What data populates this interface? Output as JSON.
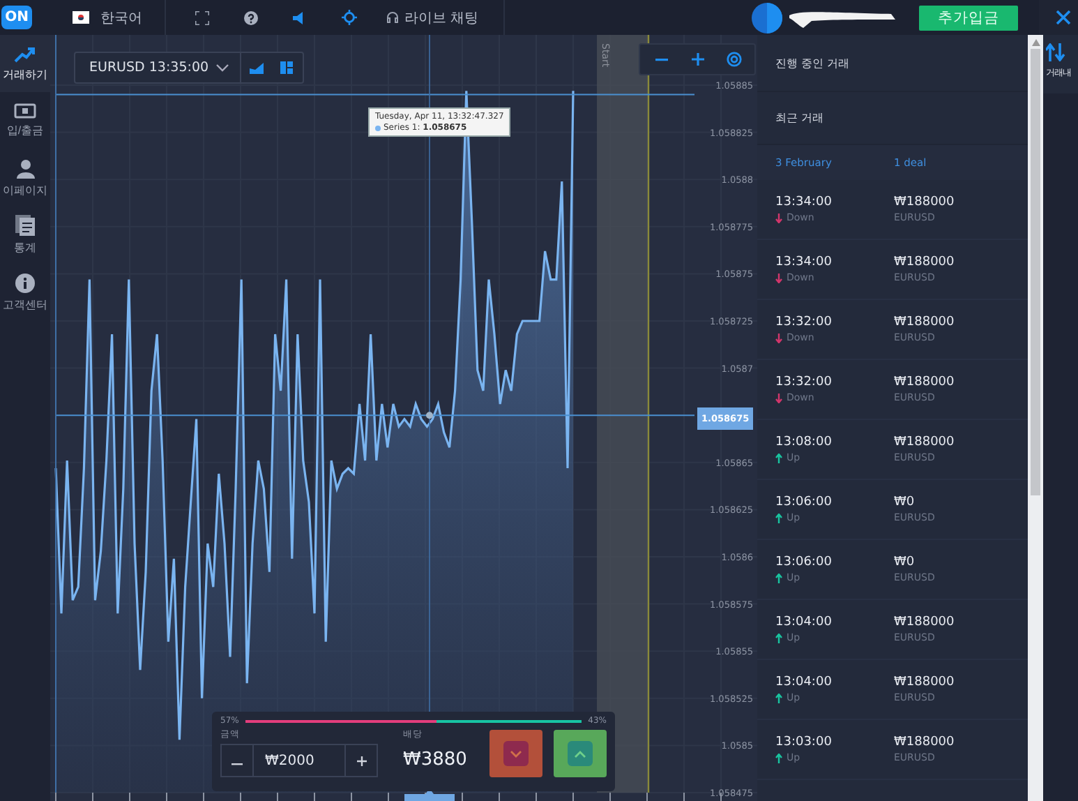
{
  "logo": {
    "text": "ON"
  },
  "top_bar": {
    "language": "한국어",
    "live_chat": "라이브 채팅",
    "deposit_button": "추가입금"
  },
  "sidebar": {
    "items": [
      {
        "label": "거래하기",
        "kind": "trend",
        "selected": true
      },
      {
        "label": "입/출금",
        "kind": "cash",
        "selected": false
      },
      {
        "label": "이페이지",
        "kind": "person",
        "selected": false
      },
      {
        "label": "통계",
        "kind": "document",
        "selected": false
      },
      {
        "label": "고객센터",
        "kind": "info",
        "selected": false
      }
    ]
  },
  "asset_selector": {
    "label": "EURUSD 13:35:00"
  },
  "chart": {
    "tooltip": {
      "date": "Tuesday, Apr 11, 13:32:47.327",
      "series_suffix": ":",
      "value": "1.058675"
    },
    "price_tag": "1.058675",
    "start_label": "Start",
    "chart_data": {
      "type": "area",
      "ylim": [
        1.058475,
        1.058875
      ],
      "grid": true,
      "ref_lines": [
        {
          "axis": "y",
          "value": 1.058845
        },
        {
          "axis": "y",
          "value": 1.058675
        }
      ],
      "yticks": [
        1.05885,
        1.058825,
        1.0588,
        1.058775,
        1.05875,
        1.058725,
        1.0587,
        1.05865,
        1.058625,
        1.0586,
        1.058575,
        1.05855,
        1.058525,
        1.0585,
        1.058475
      ],
      "series": [
        {
          "name": "Series 1",
          "color": "#7ab4f0",
          "values": [
            1.058647,
            1.05857,
            1.058651,
            1.058577,
            1.058584,
            1.058647,
            1.058747,
            1.058577,
            1.058603,
            1.058651,
            1.058718,
            1.05857,
            1.058636,
            1.058747,
            1.058607,
            1.05854,
            1.058592,
            1.058688,
            1.058718,
            1.058651,
            1.058555,
            1.058599,
            1.058503,
            1.058584,
            1.058629,
            1.058673,
            1.058525,
            1.058607,
            1.058584,
            1.058644,
            1.058607,
            1.058547,
            1.058636,
            1.058747,
            1.058533,
            1.058607,
            1.058651,
            1.058636,
            1.058592,
            1.058718,
            1.058688,
            1.058747,
            1.058599,
            1.058718,
            1.058651,
            1.058629,
            1.05857,
            1.058747,
            1.058555,
            1.058651,
            1.058636,
            1.058644,
            1.058647,
            1.058644,
            1.058681,
            1.058651,
            1.058718,
            1.058651,
            1.058681,
            1.058658,
            1.058681,
            1.058669,
            1.058673,
            1.058669,
            1.058681,
            1.058673,
            1.058669,
            1.058673,
            1.058681,
            1.058666,
            1.058658,
            1.058688,
            1.058747,
            1.058847,
            1.058777,
            1.058699,
            1.058688,
            1.058747,
            1.058718,
            1.058681,
            1.058699,
            1.058688,
            1.058718,
            1.058725,
            1.058725,
            1.058725,
            1.058725,
            1.058762,
            1.058747,
            1.058747,
            1.058799,
            1.058647,
            1.058847
          ]
        }
      ]
    }
  },
  "trade_widget": {
    "down_percent": "57%",
    "up_percent": "43%",
    "level": 0.57,
    "amount_label": "금액",
    "amount": "₩2000",
    "payout_label": "배당",
    "payout": "₩3880"
  },
  "trades_panel": {
    "open_title": "진행 중인 거래",
    "recent_title": "최근 거래",
    "date": "3 February",
    "deal_count": "1 deal",
    "rows": [
      {
        "time": "13:34:00",
        "direction": "Down",
        "kind": "down",
        "amount": "₩188000",
        "pair": "EURUSD"
      },
      {
        "time": "13:34:00",
        "direction": "Down",
        "kind": "down",
        "amount": "₩188000",
        "pair": "EURUSD"
      },
      {
        "time": "13:32:00",
        "direction": "Down",
        "kind": "down",
        "amount": "₩188000",
        "pair": "EURUSD"
      },
      {
        "time": "13:32:00",
        "direction": "Down",
        "kind": "down",
        "amount": "₩188000",
        "pair": "EURUSD"
      },
      {
        "time": "13:08:00",
        "direction": "Up",
        "kind": "up",
        "amount": "₩188000",
        "pair": "EURUSD"
      },
      {
        "time": "13:06:00",
        "direction": "Up",
        "kind": "up",
        "amount": "₩0",
        "pair": "EURUSD"
      },
      {
        "time": "13:06:00",
        "direction": "Up",
        "kind": "up",
        "amount": "₩0",
        "pair": "EURUSD"
      },
      {
        "time": "13:04:00",
        "direction": "Up",
        "kind": "up",
        "amount": "₩188000",
        "pair": "EURUSD"
      },
      {
        "time": "13:04:00",
        "direction": "Up",
        "kind": "up",
        "amount": "₩188000",
        "pair": "EURUSD"
      },
      {
        "time": "13:03:00",
        "direction": "Up",
        "kind": "up",
        "amount": "₩188000",
        "pair": "EURUSD"
      }
    ]
  },
  "history_tab": {
    "label": "거래내"
  }
}
